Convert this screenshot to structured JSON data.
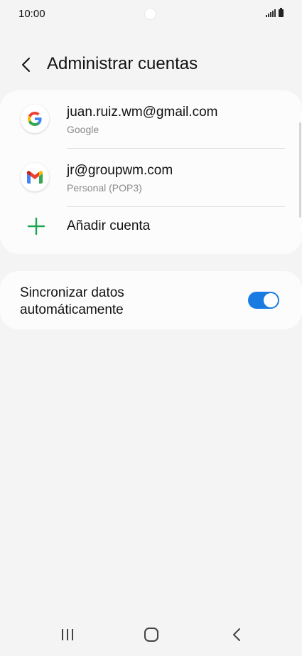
{
  "status_bar": {
    "time": "10:00"
  },
  "header": {
    "title": "Administrar cuentas"
  },
  "accounts": [
    {
      "email": "juan.ruiz.wm@gmail.com",
      "type": "Google",
      "icon": "google-icon"
    },
    {
      "email": "jr@groupwm.com",
      "type": "Personal (POP3)",
      "icon": "gmail-icon"
    }
  ],
  "add_account": {
    "label": "Añadir cuenta"
  },
  "sync": {
    "label": "Sincronizar datos automáticamente",
    "enabled": true
  },
  "colors": {
    "accent": "#1a7ce2",
    "plus_green": "#1aa550",
    "background": "#f4f4f4"
  },
  "nav": {
    "recents_icon": "recents-icon",
    "home_icon": "home-icon",
    "back_icon": "back-icon"
  }
}
